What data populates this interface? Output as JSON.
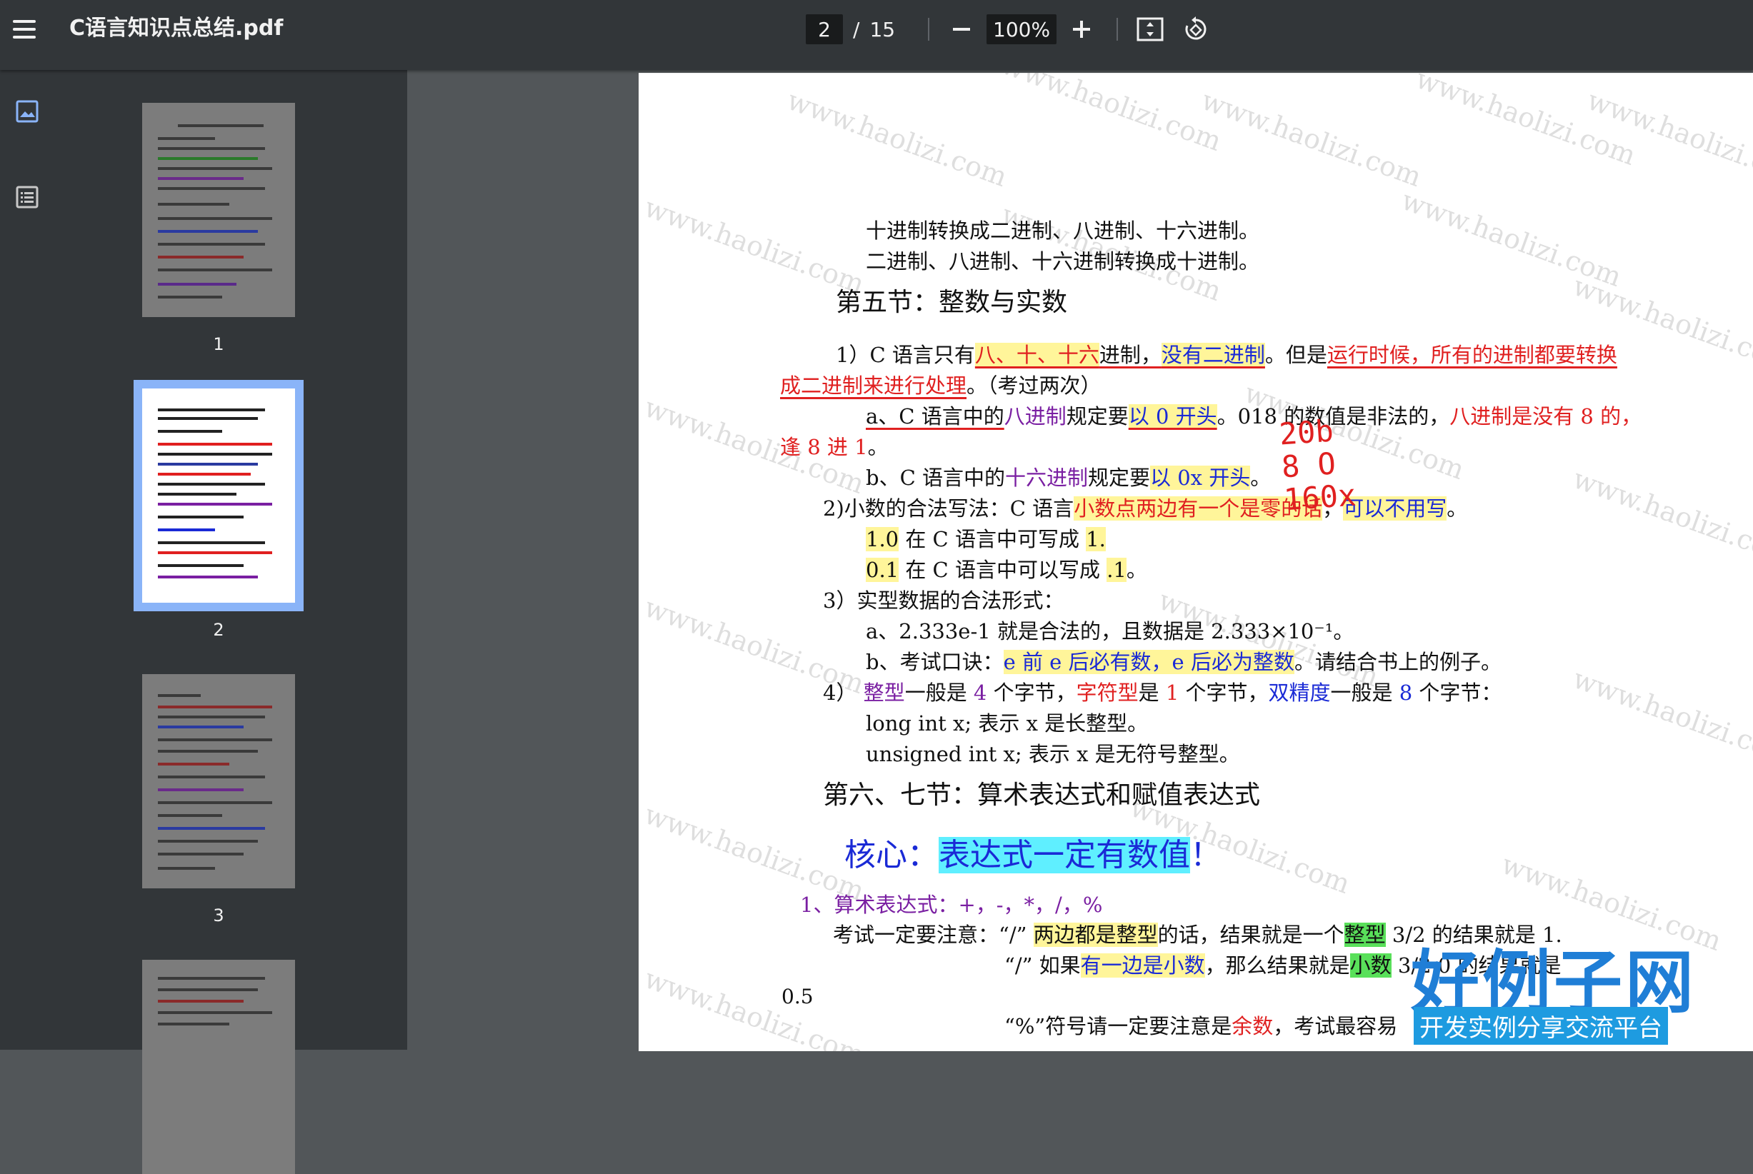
{
  "app": {
    "title": "C语言知识点总结.pdf"
  },
  "toolbar": {
    "page_current": "2",
    "page_separator": "/",
    "page_total": "15",
    "zoom": "100%",
    "icons": [
      "menu-icon",
      "zoom-out-icon",
      "zoom-in-icon",
      "fit-page-icon",
      "rotate-icon"
    ]
  },
  "sidebar": {
    "icons": [
      "thumbnails-icon",
      "outline-icon"
    ],
    "thumbnails": [
      {
        "label": "1"
      },
      {
        "label": "2",
        "active": true
      },
      {
        "label": "3"
      },
      {
        "label": ""
      }
    ]
  },
  "document": {
    "line1": "十进制转换成二进制、八进制、十六进制。",
    "line2": "二进制、八进制、十六进制转换成十进制。",
    "section5_title": "第五节：整数与实数",
    "p1_a": "1）C 语言只有",
    "p1_b": "八、十、十六",
    "p1_c": "进制，",
    "p1_d": "没有二进制",
    "p1_e": "。但是",
    "p1_f": "运行时候，所有的进制都要转换",
    "p1_g": "成二进制来进行处理",
    "p1_h": "。（考过两次）",
    "pa_a": "a、C 语言中的",
    "pa_b": "八进制",
    "pa_c": "规定要",
    "pa_d": "以 0 开头",
    "pa_e": "。018 的数值是非法的，",
    "pa_f": "八进制是没有 8 的，",
    "pa_g": "逢 8 进 1",
    "pa_h": "。",
    "pb_a": "b、C 语言中的",
    "pb_b": "十六进制",
    "pb_c": "规定要",
    "pb_d": "以 0x 开头",
    "pb_e": "。",
    "p2_a": "2)小数的合法写法：C 语言",
    "p2_b": "小数点两边有一个是零的话",
    "p2_c": "，",
    "p2_d": "可以不用写",
    "p2_e": "。",
    "p2_l1_a": "1.0",
    "p2_l1_b": " 在 C 语言中可写成 ",
    "p2_l1_c": "1.",
    "p2_l2_a": "0.1",
    "p2_l2_b": " 在 C 语言中可以写成 ",
    "p2_l2_c": ".1",
    "p2_l2_d": "。",
    "p3": "3）实型数据的合法形式：",
    "p3a": "a、2.333e-1 就是合法的，且数据是 2.333×10⁻¹。",
    "p3b_a": "b、考试口诀：",
    "p3b_b": "e 前 e 后必有数，e 后必为整数",
    "p3b_c": "。请结合书上的例子。",
    "p4_a": "4）  ",
    "p4_b": "整型",
    "p4_c": "一般是 ",
    "p4_d": "4",
    "p4_e": " 个字节，",
    "p4_f": "字符型",
    "p4_g": "是 ",
    "p4_h": "1",
    "p4_i": " 个字节，",
    "p4_j": "双精度",
    "p4_k": "一般是 ",
    "p4_l": "8",
    "p4_m": " 个字节：",
    "p4_l1": "long int x; 表示 x 是长整型。",
    "p4_l2": "unsigned int x; 表示 x 是无符号整型。",
    "section67_title": "第六、七节：算术表达式和赋值表达式",
    "core_a": "核心：",
    "core_b": "表达式一定有数值",
    "core_c": "！",
    "arith_title": "1、算术表达式：+，-，*，/，%",
    "exam_a": "考试一定要注意：“/”  ",
    "exam_b": "两边都是整型",
    "exam_c": "的话，结果就是一个",
    "exam_d": "整型",
    "exam_e": "  3/2 的结果就是 1.",
    "exam2_a": "“/”  如果",
    "exam2_b": "有一边是小数",
    "exam2_c": "，那么结果就是",
    "exam2_d": "小数",
    "exam2_e": "  3/2.0 的结果就是",
    "exam3_a": "“%”符号请一定要注意是",
    "exam3_b": "余数",
    "exam3_c": "，考试最容易",
    "handwriting": [
      "20b",
      "8 O",
      "160x"
    ],
    "page_footer": "0.5",
    "watermark": "www.haolizi.com"
  },
  "overlay": {
    "logo_main": "好例子网",
    "logo_sub": "开发实例分享交流平台"
  },
  "colors": {
    "toolbar_bg": "#323639",
    "viewer_bg": "#525659",
    "active_thumb_outline": "#8ab4f8",
    "red": "#e02020",
    "blue": "#1a2ad6",
    "purple": "#7a1fa2"
  }
}
